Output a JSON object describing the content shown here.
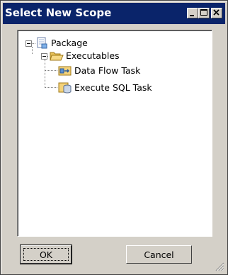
{
  "window": {
    "title": "Select New Scope",
    "title_bar_color": "#0a246a",
    "face_color": "#d4d0c8",
    "controls": [
      "minimize-icon",
      "maximize-icon",
      "close-icon"
    ]
  },
  "tree": {
    "items": [
      {
        "label": "Package",
        "icon": "package-icon",
        "expanded": true
      },
      {
        "label": "Executables",
        "icon": "folder-open-icon",
        "expanded": true
      },
      {
        "label": "Data Flow Task",
        "icon": "data-flow-task-icon"
      },
      {
        "label": "Execute SQL Task",
        "icon": "execute-sql-task-icon"
      }
    ]
  },
  "buttons": {
    "ok_label": "OK",
    "cancel_label": "Cancel"
  }
}
